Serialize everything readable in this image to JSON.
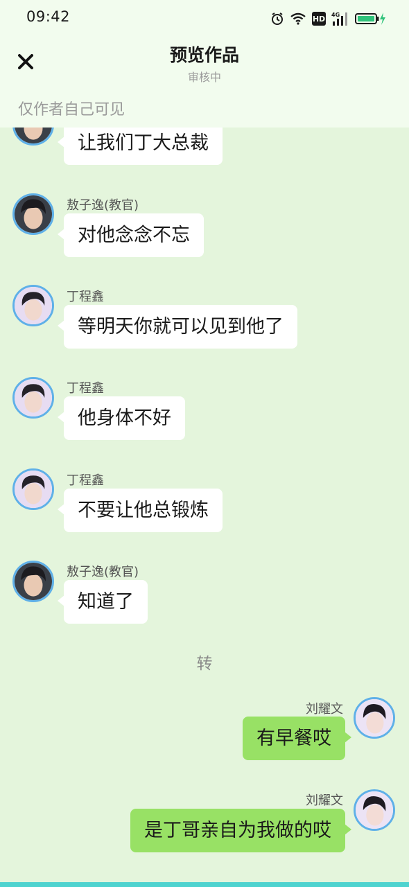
{
  "status_bar": {
    "time": "09:42",
    "icons": [
      "alarm-icon",
      "wifi-icon",
      "hd-icon",
      "signal-4g-icon",
      "battery-icon",
      "charging-icon"
    ],
    "hd_label": "HD",
    "network_label": "4G"
  },
  "header": {
    "close_icon": "close-icon",
    "title": "预览作品",
    "subtitle": "审核中",
    "visibility_note": "仅作者自己可见"
  },
  "colors": {
    "background": "#e4f5dc",
    "header_bg": "#f2fcee",
    "right_bubble": "#98e165",
    "left_bubble": "#ffffff",
    "avatar_ring": "#5fb0e8",
    "bottom_accent": "#4fd3cf"
  },
  "messages": [
    {
      "side": "left",
      "sender": "",
      "text": "让我们丁大总裁",
      "avatar": "avatar-ao"
    },
    {
      "side": "left",
      "sender": "敖子逸(教官)",
      "text": "对他念念不忘",
      "avatar": "avatar-ao"
    },
    {
      "side": "left",
      "sender": "丁程鑫",
      "text": "等明天你就可以见到他了",
      "avatar": "avatar-ding"
    },
    {
      "side": "left",
      "sender": "丁程鑫",
      "text": "他身体不好",
      "avatar": "avatar-ding"
    },
    {
      "side": "left",
      "sender": "丁程鑫",
      "text": "不要让他总锻炼",
      "avatar": "avatar-ding"
    },
    {
      "side": "left",
      "sender": "敖子逸(教官)",
      "text": "知道了",
      "avatar": "avatar-ao"
    },
    {
      "side": "right",
      "sender": "刘耀文",
      "text": "有早餐哎",
      "avatar": "avatar-liu"
    },
    {
      "side": "right",
      "sender": "刘耀文",
      "text": "是丁哥亲自为我做的哎",
      "avatar": "avatar-liu"
    }
  ],
  "divider": "转"
}
